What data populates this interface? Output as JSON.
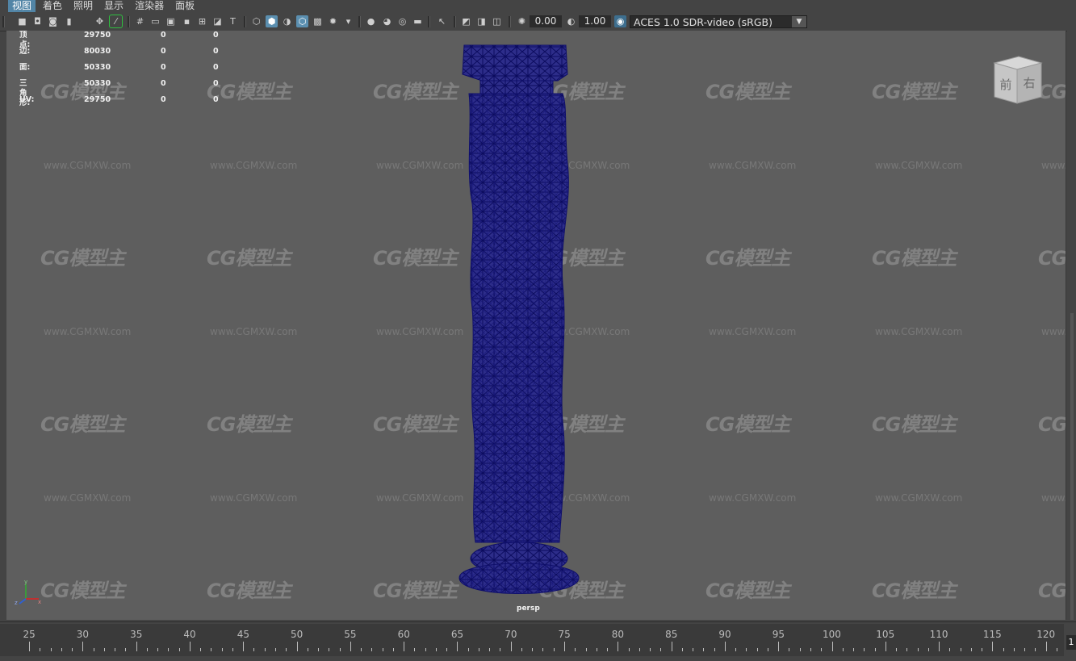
{
  "menu": {
    "items": [
      {
        "label": "视图",
        "active": true
      },
      {
        "label": "着色",
        "active": false
      },
      {
        "label": "照明",
        "active": false
      },
      {
        "label": "显示",
        "active": false
      },
      {
        "label": "渲染器",
        "active": false
      },
      {
        "label": "面板",
        "active": false
      }
    ]
  },
  "toolbar": {
    "exposure_value": "0.00",
    "gamma_value": "1.00",
    "color_space": "ACES 1.0 SDR-video (sRGB)",
    "icons": [
      "camera-select-icon",
      "camera-attributes-icon",
      "bookmarks-icon",
      "image-plane-icon",
      "camera-move-icon",
      "grease-pencil-icon",
      "grid-icon",
      "film-gate-icon",
      "resolution-gate-icon",
      "gate-mask-icon",
      "field-chart-icon",
      "safe-action-icon",
      "safe-title-icon",
      "wireframe-icon",
      "smooth-shade-icon",
      "use-default-material-icon",
      "wireframe-on-shaded-icon",
      "xray-icon",
      "textured-icon",
      "lights-icon",
      "shadows-icon",
      "screen-space-ao-icon",
      "motion-blur-icon",
      "antialias-icon",
      "depth-of-field-icon",
      "isolate-select-icon",
      "xray-joints-icon",
      "xray-active-icon",
      "backface-culling-icon",
      "exposure-icon",
      "gamma-icon",
      "color-management-icon"
    ]
  },
  "hud": {
    "rows": [
      {
        "label": "顶点:",
        "v1": "29750",
        "v2": "0",
        "v3": "0"
      },
      {
        "label": "边:",
        "v1": "80030",
        "v2": "0",
        "v3": "0"
      },
      {
        "label": "面:",
        "v1": "50330",
        "v2": "0",
        "v3": "0"
      },
      {
        "label": "三角形:",
        "v1": "50330",
        "v2": "0",
        "v3": "0"
      },
      {
        "label": "UV:",
        "v1": "29750",
        "v2": "0",
        "v3": "0"
      }
    ]
  },
  "viewport": {
    "camera_label": "persp",
    "viewcube": {
      "front": "前",
      "right": "右"
    },
    "watermark_logo": "CG模型主",
    "watermark_url": "www.CGMXW.com",
    "mesh_color": "#1a1a8c",
    "background_color": "#5e5e5e"
  },
  "timeline": {
    "labels": [
      "25",
      "30",
      "35",
      "40",
      "45",
      "50",
      "55",
      "60",
      "65",
      "70",
      "75",
      "80",
      "85",
      "90",
      "95",
      "100",
      "105",
      "110",
      "115",
      "120"
    ],
    "current_frame": "1"
  },
  "colors": {
    "accent": "#5285a6",
    "toolbar_active": "#5b8fb0",
    "mesh_wire": "#1a1a8c"
  }
}
